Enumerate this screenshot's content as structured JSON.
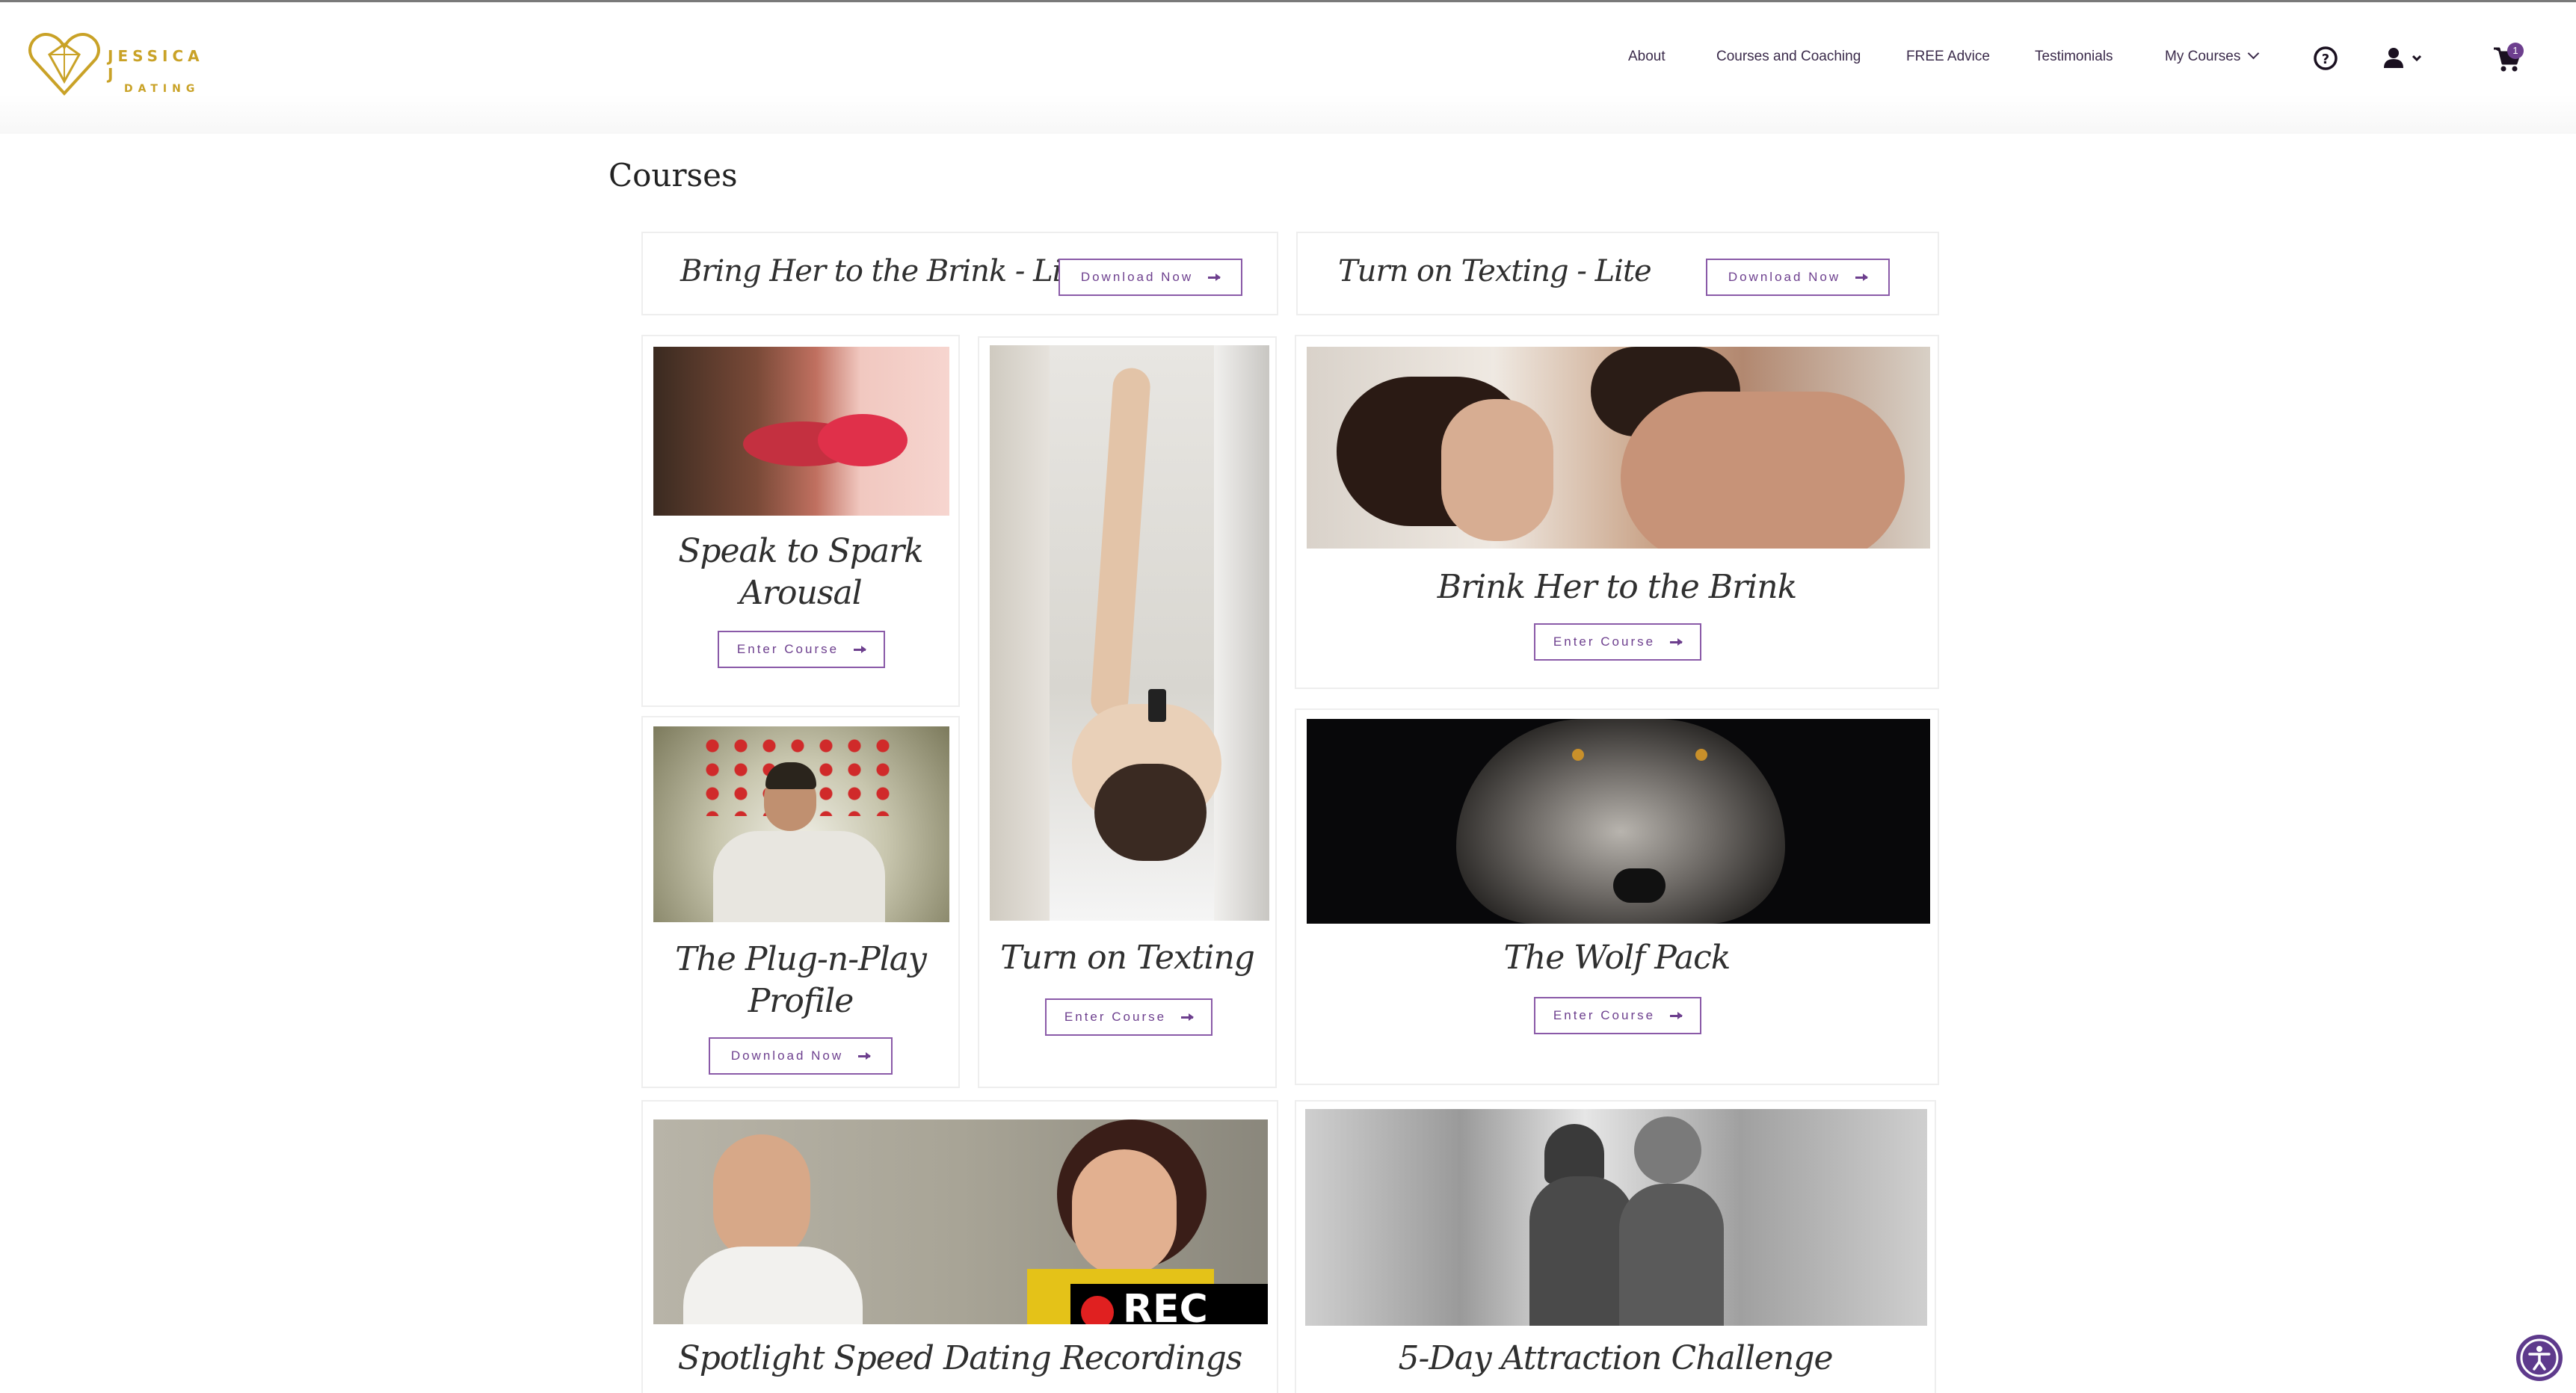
{
  "header": {
    "logo_line1": "JESSICA J",
    "logo_line2": "DATING",
    "nav": [
      "About",
      "Courses and Coaching",
      "FREE Advice",
      "Testimonials",
      "My Courses"
    ],
    "cart_count": "1"
  },
  "page": {
    "title": "Courses"
  },
  "lite": [
    {
      "title": "Bring Her to the Brink - Lite",
      "button": "Download Now"
    },
    {
      "title": "Turn on Texting - Lite",
      "button": "Download Now"
    }
  ],
  "courses": [
    {
      "title_line1": "Speak to Spark",
      "title_line2": "Arousal",
      "button": "Enter Course"
    },
    {
      "title_line1": "Turn on Texting",
      "button": "Enter Course"
    },
    {
      "title_line1": "Brink Her to the Brink",
      "button": "Enter Course"
    },
    {
      "title_line1": "The Plug-n-Play",
      "title_line2": "Profile",
      "button": "Download Now"
    },
    {
      "title_line1": "The Wolf Pack",
      "button": "Enter Course"
    },
    {
      "title_line1": "Spotlight Speed Dating Recordings",
      "rec": "REC"
    },
    {
      "title_line1": "5-Day Attraction Challenge"
    }
  ],
  "colors": {
    "accent": "#6d3f8e",
    "logo_gold": "#c9a227"
  }
}
